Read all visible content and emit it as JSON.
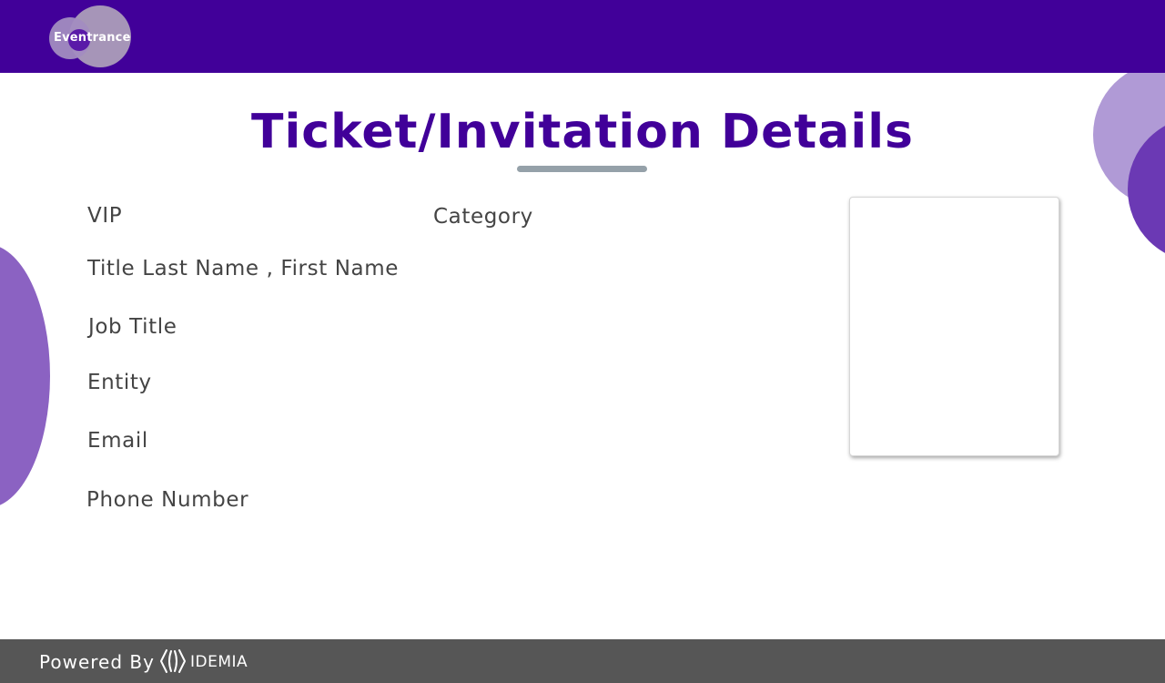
{
  "header": {
    "logo_text": "Eventrance",
    "background_color": "#410099"
  },
  "main": {
    "title": "Ticket/Invitation Details",
    "fields": {
      "ticket_type": "VIP",
      "category": "Category",
      "name": "Title Last Name , First Name",
      "job_title": "Job Title",
      "entity": "Entity",
      "email": "Email",
      "phone": "Phone Number"
    },
    "title_color": "#410099",
    "text_color": "#444444"
  },
  "footer": {
    "powered_by": "Powered By",
    "brand": "IDEMIA",
    "brand_icon": "idemia-logo-icon",
    "background_color": "#565656"
  }
}
